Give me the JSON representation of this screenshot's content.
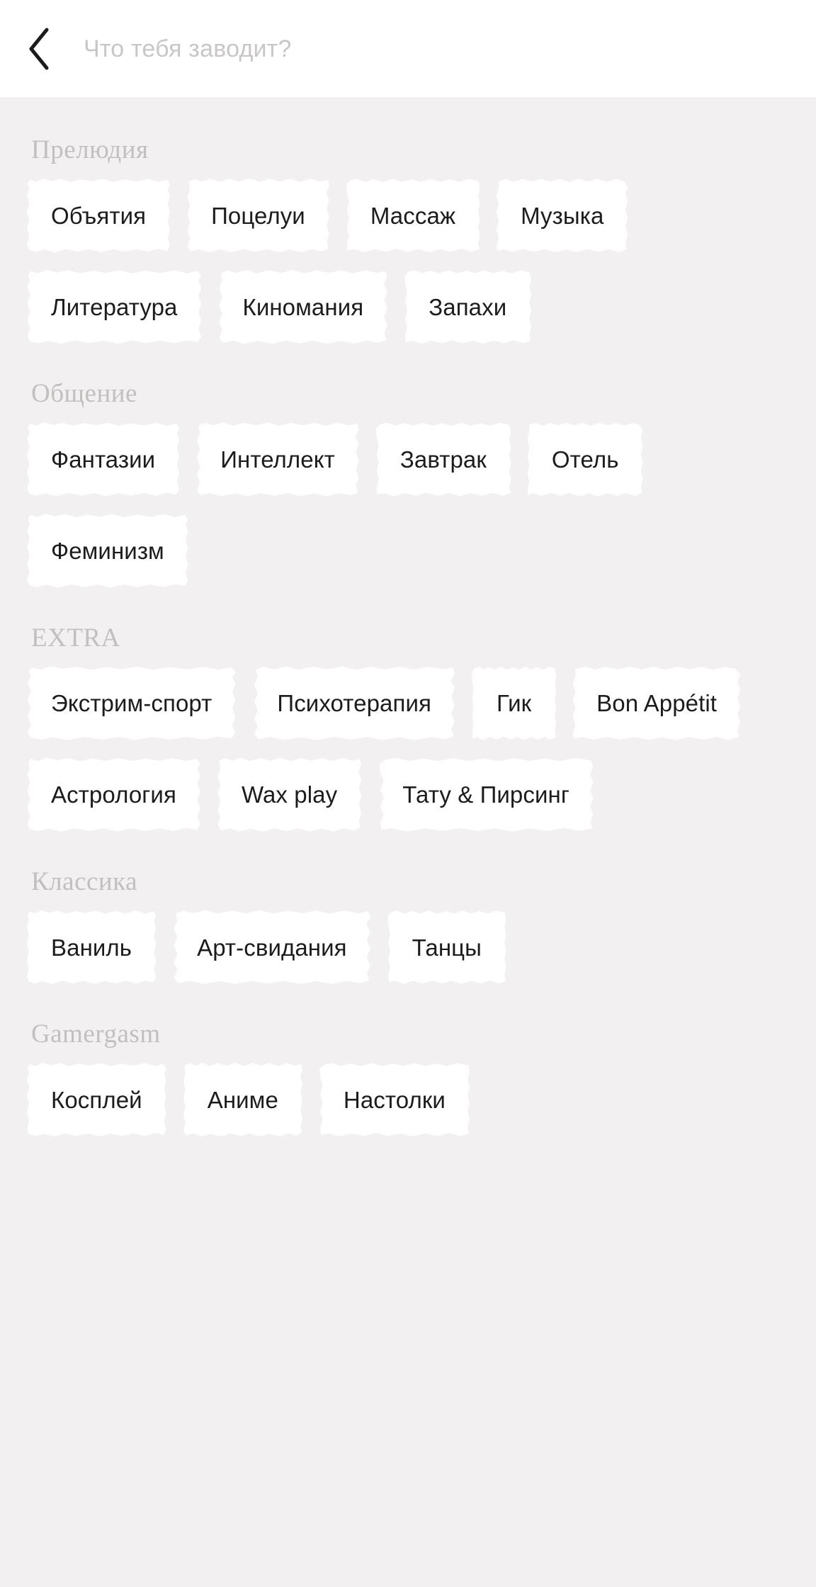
{
  "header": {
    "back_icon": "chevron-left-icon",
    "title": "Что тебя заводит?",
    "title_color": "#c9c6c6"
  },
  "theme": {
    "background": "#f2f0f0",
    "header_background": "#ffffff",
    "chip_background": "#ffffff",
    "chip_text_color": "#1c1c1c",
    "section_title_color": "#c2bfbf"
  },
  "sections": [
    {
      "title": "Прелюдия",
      "chips": [
        {
          "label": "Объятия"
        },
        {
          "label": "Поцелуи"
        },
        {
          "label": "Массаж"
        },
        {
          "label": "Музыка"
        },
        {
          "label": "Литература"
        },
        {
          "label": "Киномания"
        },
        {
          "label": "Запахи"
        }
      ]
    },
    {
      "title": "Общение",
      "chips": [
        {
          "label": "Фантазии"
        },
        {
          "label": "Интеллект"
        },
        {
          "label": "Завтрак"
        },
        {
          "label": "Отель"
        },
        {
          "label": "Феминизм"
        }
      ]
    },
    {
      "title": "EXTRA",
      "chips": [
        {
          "label": "Экстрим-спорт"
        },
        {
          "label": "Психотерапия"
        },
        {
          "label": "Гик"
        },
        {
          "label": "Bon Appétit"
        },
        {
          "label": "Астрология"
        },
        {
          "label": "Wax play"
        },
        {
          "label": "Тату & Пирсинг"
        }
      ]
    },
    {
      "title": "Классика",
      "chips": [
        {
          "label": "Ваниль"
        },
        {
          "label": "Арт-свидания"
        },
        {
          "label": "Танцы"
        }
      ]
    },
    {
      "title": "Gamergasm",
      "chips": [
        {
          "label": "Косплей"
        },
        {
          "label": "Аниме"
        },
        {
          "label": "Настолки"
        }
      ]
    }
  ]
}
